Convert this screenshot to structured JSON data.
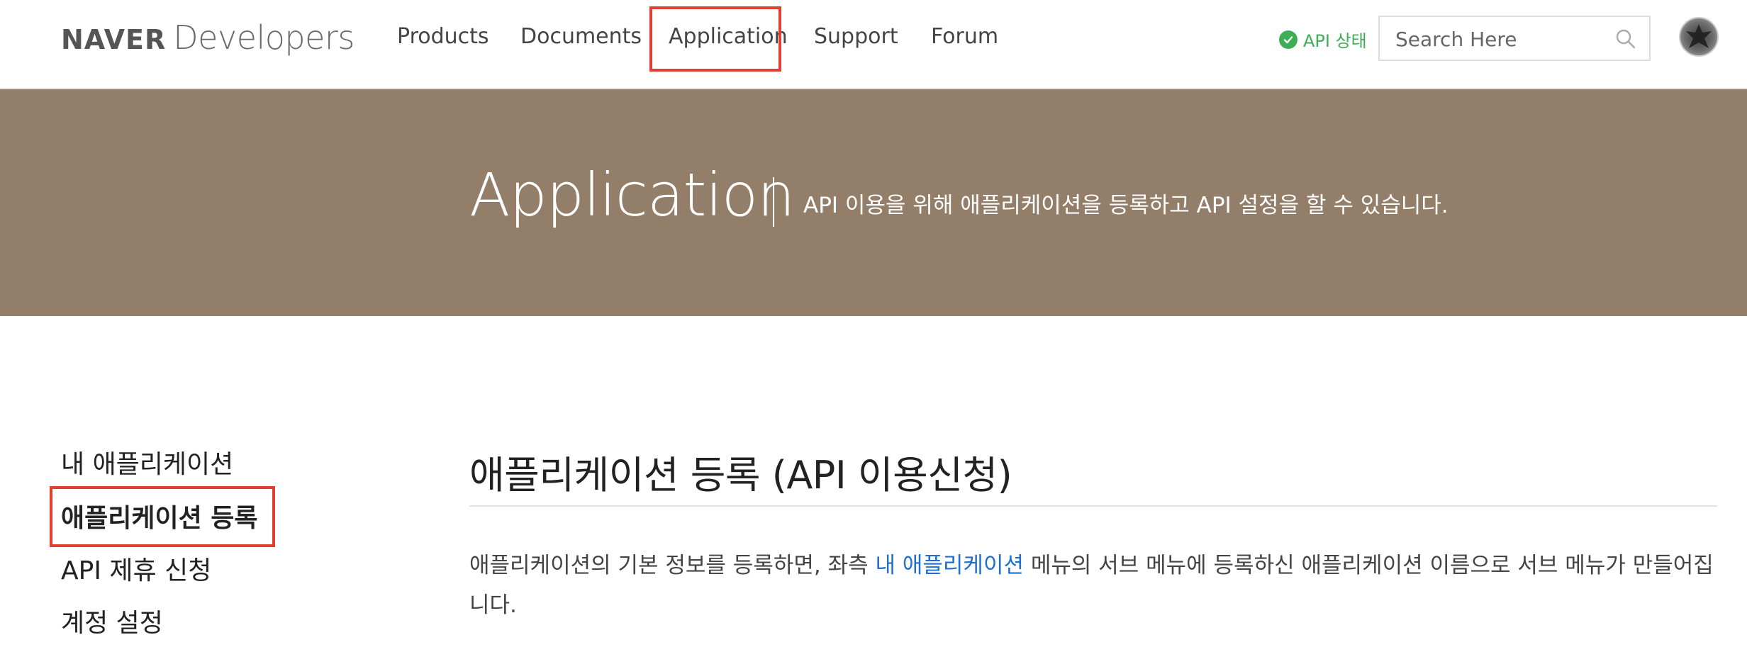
{
  "header": {
    "logo_naver": "NAVER",
    "logo_developers": "Developers",
    "nav": [
      {
        "label": "Products"
      },
      {
        "label": "Documents"
      },
      {
        "label": "Application"
      },
      {
        "label": "Support"
      },
      {
        "label": "Forum"
      }
    ],
    "api_status_label": "API 상태",
    "search_placeholder": "Search Here",
    "status_color": "#3dae55"
  },
  "banner": {
    "title": "Application",
    "subtitle": "API 이용을 위해 애플리케이션을 등록하고 API 설정을 할 수 있습니다.",
    "bg_color": "#937f69"
  },
  "sidebar": {
    "items": [
      {
        "label": "내 애플리케이션"
      },
      {
        "label": "애플리케이션 등록"
      },
      {
        "label": "API 제휴 신청"
      },
      {
        "label": "계정 설정"
      }
    ]
  },
  "main": {
    "title": "애플리케이션 등록 (API 이용신청)",
    "desc_before": "애플리케이션의 기본 정보를 등록하면, 좌측 ",
    "desc_link": "내 애플리케이션",
    "desc_after": " 메뉴의 서브 메뉴에 등록하신 애플리케이션 이름으로 서브 메뉴가 만들어집니다."
  },
  "highlight_color": "#e23f2f",
  "link_color": "#1f6fd1"
}
